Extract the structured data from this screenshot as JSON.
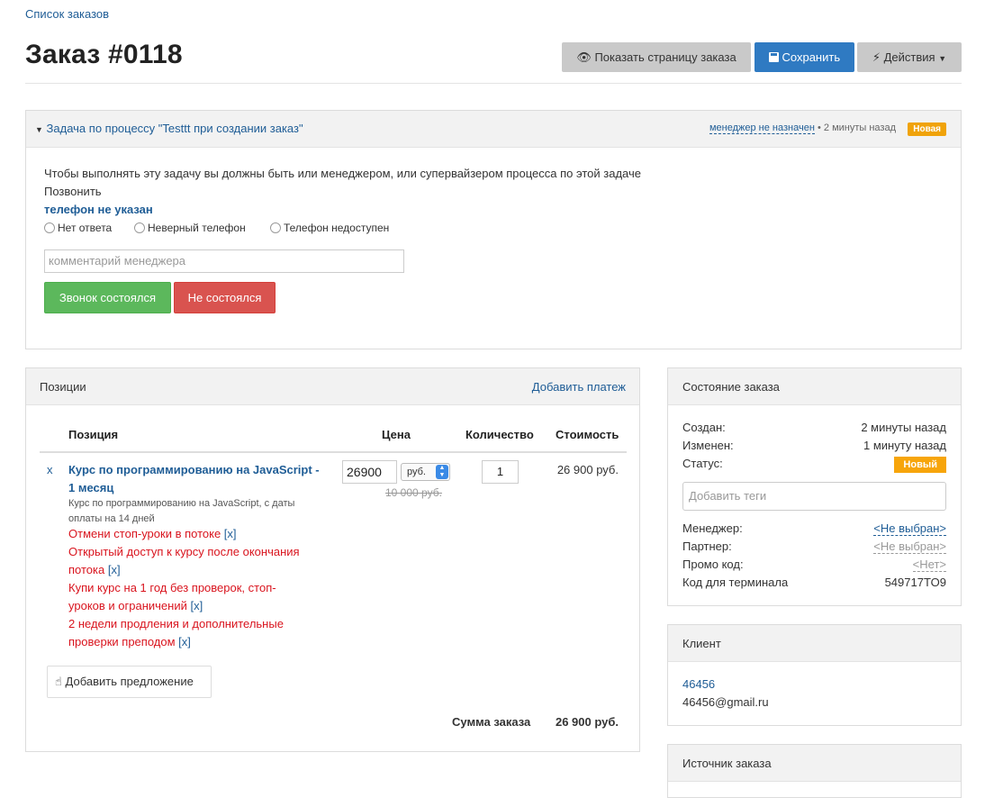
{
  "breadcrumb": "Список заказов",
  "title": "Заказ #0118",
  "header_buttons": {
    "show_page": "Показать страницу заказа",
    "save": "Сохранить",
    "actions": "Действия"
  },
  "task": {
    "title": "Задача по процессу \"Testtt при создании заказ\"",
    "manager": "менеджер не назначен",
    "time": "• 2 минуты назад",
    "status": "Новая",
    "notice": "Чтобы выполнять эту задачу вы должны быть или менеджером, или супервайзером процесса по этой задаче",
    "action": "Позвонить",
    "phone": "телефон не указан",
    "radios": [
      "Нет ответа",
      "Неверный телефон",
      "Телефон недоступен"
    ],
    "comment_placeholder": "комментарий менеджера",
    "btn_ok": "Звонок состоялся",
    "btn_fail": "Не состоялся"
  },
  "positions": {
    "title": "Позиции",
    "add_payment": "Добавить платеж",
    "columns": [
      "Позиция",
      "Цена",
      "Количество",
      "Стоимость"
    ],
    "item": {
      "remove": "x",
      "name_line1": "Курс по программированию на JavaScript -",
      "name_line2": "1 месяц",
      "desc_line1": "Курс по программированию на JavaScript, с даты",
      "desc_line2": "оплаты на 14 дней",
      "price": "26900",
      "currency": "руб.",
      "old_price": "10 000 руб.",
      "qty": "1",
      "cost": "26 900 руб.",
      "options": [
        {
          "lines": [
            "Отмени стоп-уроки в потоке"
          ],
          "x": "[x]"
        },
        {
          "lines": [
            "Открытый доступ к курсу после окончания",
            "потока"
          ],
          "x": "[x]"
        },
        {
          "lines": [
            "Купи курс на 1 год без проверок, стоп-",
            "уроков и ограничений"
          ],
          "x": "[x]"
        },
        {
          "lines": [
            "2 недели продления и дополнительные",
            "проверки преподом"
          ],
          "x": "[x]"
        }
      ]
    },
    "add_offer": "Добавить предложение",
    "total_label": "Сумма заказа",
    "total_value": "26 900 руб."
  },
  "state": {
    "title": "Состояние заказа",
    "created_label": "Создан:",
    "created_value": "2 минуты назад",
    "changed_label": "Изменен:",
    "changed_value": "1 минуту назад",
    "status_label": "Статус:",
    "status_value": "Новый",
    "tags_placeholder": "Добавить теги",
    "manager_label": "Менеджер:",
    "manager_value": "<Не выбран>",
    "partner_label": "Партнер:",
    "partner_value": "<Не выбран>",
    "promo_label": "Промо код:",
    "promo_value": "<Нет>",
    "terminal_label": "Код для терминала",
    "terminal_value": "549717TO9"
  },
  "client": {
    "title": "Клиент",
    "name": "46456",
    "email": "46456@gmail.ru"
  },
  "source": {
    "title": "Источник заказа"
  },
  "colors": {
    "link": "#1f5d96",
    "primary": "#2f7ac2",
    "success": "#5cb85c",
    "danger": "#d9534f",
    "warning": "#f0a30a",
    "option_red": "#d9141e"
  }
}
